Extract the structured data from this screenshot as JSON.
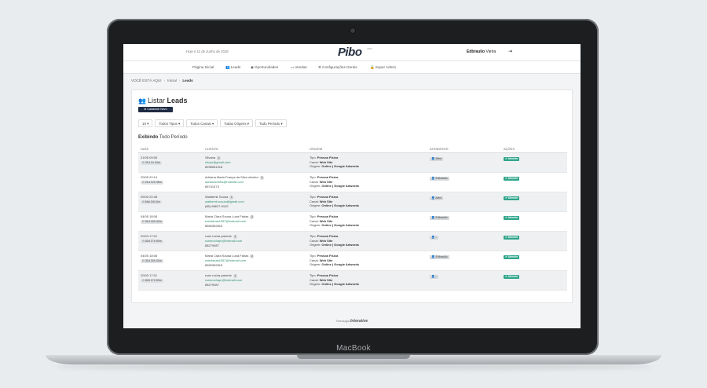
{
  "device": {
    "label": "MacBook"
  },
  "topbar": {
    "date_text": "Hoje é 11 de Junho de 2018",
    "logo": "Pibo",
    "logo_tm": "CRM",
    "user_first": "Edbraulio",
    "user_last": "Vieira"
  },
  "nav": [
    {
      "label": "Página Inicial",
      "icon": ""
    },
    {
      "label": "Leads",
      "icon": "users-icon"
    },
    {
      "label": "Oportunidades",
      "icon": "eye-icon"
    },
    {
      "label": "Vendas",
      "icon": "money-icon"
    },
    {
      "label": "Configurações Gerais",
      "icon": "gears-icon"
    },
    {
      "label": "Super Admin",
      "icon": "lock-icon"
    }
  ],
  "breadcrumb": {
    "label": "VOCÊ ESTÁ AQUI",
    "home": "Inicial",
    "current": "Leads"
  },
  "page": {
    "title_prefix": "Listar",
    "title_strong": "Leads",
    "new_button": "Cadastrar Novo"
  },
  "filters": [
    "10",
    "Todos Tipos",
    "Todos Canais",
    "Todas Origens",
    "Todo Período"
  ],
  "exibindo": {
    "label": "Exibindo",
    "value": "Todo Período"
  },
  "table": {
    "headers": [
      "DATA",
      "CLIENTE",
      "ORIGEM",
      "ATENDENTE",
      "AÇÕES"
    ],
    "tipo_label": "Tipo:",
    "canal_label": "Canal:",
    "origem_label": "Origem:",
    "rows": [
      {
        "date": "21/06 09:06",
        "ago": "21d 1h 44m",
        "name": "Silvana",
        "count": "1",
        "email": "silvpn@gmail.com",
        "phone": "8998081918",
        "tipo": "Pessoa Física",
        "canal": "Web Site",
        "origem": "Online | Google Adwords",
        "attendant": "Aline",
        "action": "Atender"
      },
      {
        "date": "20/05 22:14",
        "ago": "21d 12h 36m",
        "name": "Adriana Maria França da Silva oliveira",
        "count": "1",
        "email": "adrianaomfrs@hotmail.com",
        "phone": "85741473",
        "tipo": "Pessoa Física",
        "canal": "Web Site",
        "origem": "Online | Google Adwords",
        "attendant": "Edbraulio",
        "action": "Atender"
      },
      {
        "date": "09/05 20:48",
        "ago": "Mai 14h 3m",
        "name": "Waldemir Sousa",
        "count": "1",
        "email": "waldemir.souza@gmail.com",
        "phone": "(85) 98627-9102",
        "tipo": "Pessoa Física",
        "canal": "Web Site",
        "origem": "Online | Google Adwords",
        "attendant": "Aline",
        "action": "Atender"
      },
      {
        "date": "04/05 18:08",
        "ago": "31d 16h 42m",
        "name": "Maria Clara Sousa Luna Farias",
        "count": "2",
        "email": "ederfarias1987@hotmail.com",
        "phone": "8565352815",
        "tipo": "Pessoa Física",
        "canal": "Web Site",
        "origem": "Online | Google Adwords",
        "attendant": "Edbraulio",
        "action": "Atender"
      },
      {
        "date": "20/03 17:01",
        "ago": "82d 17h 50m",
        "name": "ruan rocha parente",
        "count": "1",
        "email": "ruanrochapr@hotmail.com",
        "phone": "88279087",
        "tipo": "Pessoa Física",
        "canal": "Web Site",
        "origem": "Online | Google Adwords",
        "attendant": "-",
        "action": "Atender"
      },
      {
        "date": "04/05 18:08",
        "ago": "31d 16h 42m",
        "name": "Maria Clara Sousa Luna Farias",
        "count": "2",
        "email": "ederfarias1987@hotmail.com",
        "phone": "8565352815",
        "tipo": "Pessoa Física",
        "canal": "Web Site",
        "origem": "Online | Google Adwords",
        "attendant": "Edbraulio",
        "action": "Atender"
      },
      {
        "date": "20/03 17:01",
        "ago": "82d 17h 50m",
        "name": "ruan rocha parente",
        "count": "1",
        "email": "ruanrochapr@hotmail.com",
        "phone": "88279087",
        "tipo": "Pessoa Física",
        "canal": "Web Site",
        "origem": "Online | Google Adwords",
        "attendant": "-",
        "action": "Atender"
      }
    ]
  },
  "footer": {
    "prefix": "Tecnologia",
    "brand": "Interative"
  },
  "colors": {
    "accent": "#2fa58b",
    "navy": "#1f2b44",
    "email": "#2f8f6e"
  }
}
